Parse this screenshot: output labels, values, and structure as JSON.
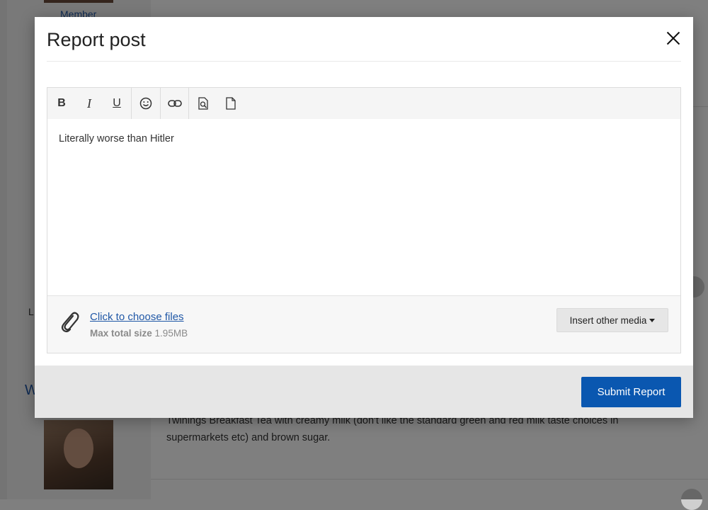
{
  "background": {
    "member_label": "Member",
    "left_letter": "L",
    "author_letter": "W",
    "post_text_line1": "Twinings Breakfast Tea with creamy milk (don't like the standard green and red milk taste choices in",
    "post_text_line2": "supermarkets etc) and brown sugar."
  },
  "modal": {
    "title": "Report post",
    "editor": {
      "toolbar": [
        {
          "name": "bold-button",
          "label": "B",
          "icon": "bold"
        },
        {
          "name": "italic-button",
          "label": "I",
          "icon": "italic"
        },
        {
          "name": "underline-button",
          "label": "U",
          "icon": "underline"
        },
        {
          "name": "emoji-button",
          "icon": "smiley-icon"
        },
        {
          "name": "link-button",
          "icon": "link-icon"
        },
        {
          "name": "preview-button",
          "icon": "preview-icon"
        },
        {
          "name": "source-button",
          "icon": "document-icon"
        }
      ],
      "content": "Literally worse than Hitler"
    },
    "attachments": {
      "choose_label": "Click to choose files",
      "max_size_label": "Max total size",
      "max_size_value": "1.95MB",
      "insert_media_label": "Insert other media"
    },
    "submit_label": "Submit Report"
  },
  "colors": {
    "primary": "#0a57b0",
    "link": "#1f57a6"
  }
}
